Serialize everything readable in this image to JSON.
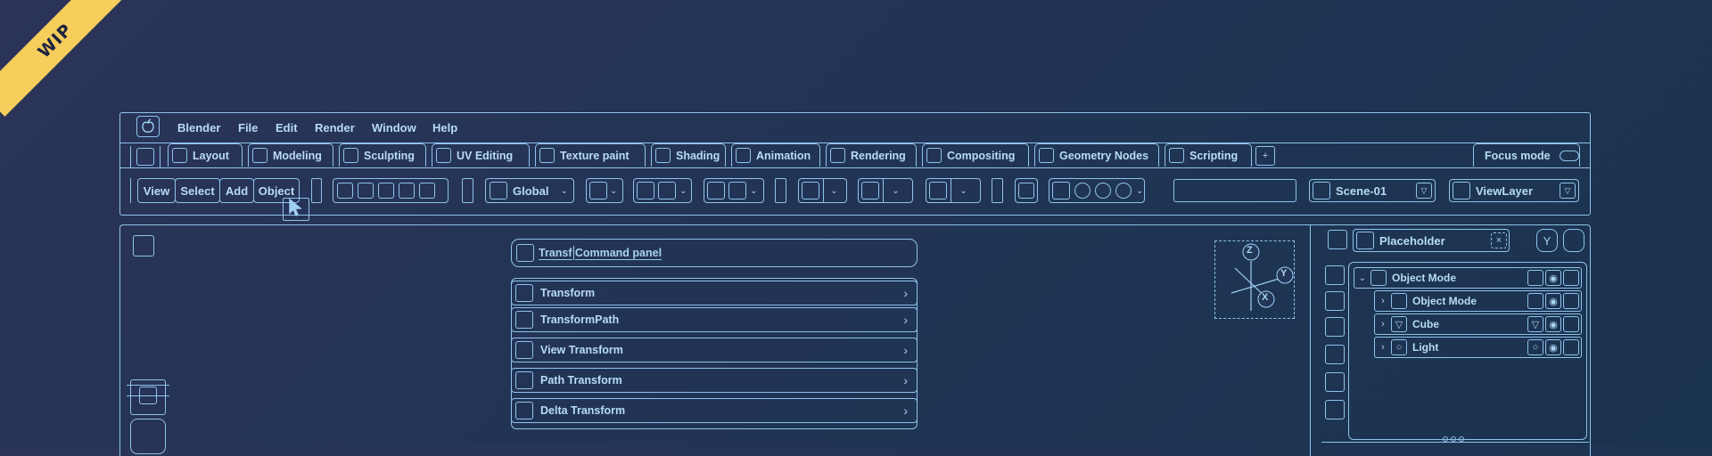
{
  "badge": {
    "label": "WIP",
    "color": "#f7cd5b"
  },
  "menubar": {
    "items": [
      "Blender",
      "File",
      "Edit",
      "Render",
      "Window",
      "Help"
    ]
  },
  "workspace_tabs": [
    "Layout",
    "Modeling",
    "Sculpting",
    "UV Editing",
    "Texture paint",
    "Shading",
    "Animation",
    "Rendering",
    "Compositing",
    "Geometry Nodes",
    "Scripting"
  ],
  "focus_mode": {
    "label": "Focus mode"
  },
  "header": {
    "view": "View",
    "select": "Select",
    "add": "Add",
    "object": "Object",
    "orientation": "Global",
    "scene": "Scene-01",
    "view_layer": "ViewLayer",
    "search_value": ""
  },
  "command_panel": {
    "search_prefix": "Transf",
    "search_rest": "Command panel",
    "items": [
      "Transform",
      "TransformPath",
      "View Transform",
      "Path Transform",
      "Delta Transform"
    ]
  },
  "gizmo": {
    "z": "Z",
    "y": "Y",
    "x": "X"
  },
  "outliner": {
    "search": "Placeholder",
    "rows": [
      {
        "label": "Object Mode",
        "level": 0
      },
      {
        "label": "Object Mode",
        "level": 1
      },
      {
        "label": "Cube",
        "level": 1
      },
      {
        "label": "Light",
        "level": 1
      }
    ]
  }
}
